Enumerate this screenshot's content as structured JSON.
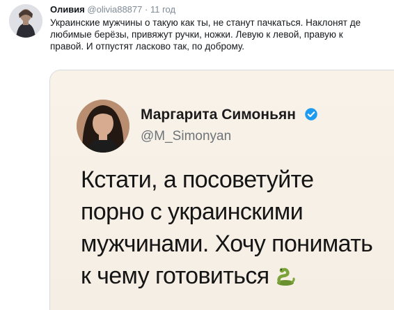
{
  "tweet": {
    "author_name": "Оливия",
    "author_handle": "@olivia88877",
    "dot": "·",
    "time": "11 год",
    "text_lines": [
      "Украинские мужчины о такую как ты, не станут пачкаться. Наклонят де",
      "любимые берёзы, привяжут ручки, ножки. Левую к левой, правую к",
      "правой. И отпустят ласково так, по доброму."
    ]
  },
  "quoted": {
    "name": "Маргарита Симоньян",
    "handle": "@M_Simonyan",
    "text_lines": [
      "Кстати, а посоветуйте",
      "порно с украинскими",
      "мужчинами. Хочу понимать",
      "к чему готовиться"
    ],
    "emoji": "snake-emoji"
  },
  "colors": {
    "verified": "#1d9bf0",
    "handle_gray": "#7d8a96",
    "quote_background": "#f6f0e7"
  }
}
